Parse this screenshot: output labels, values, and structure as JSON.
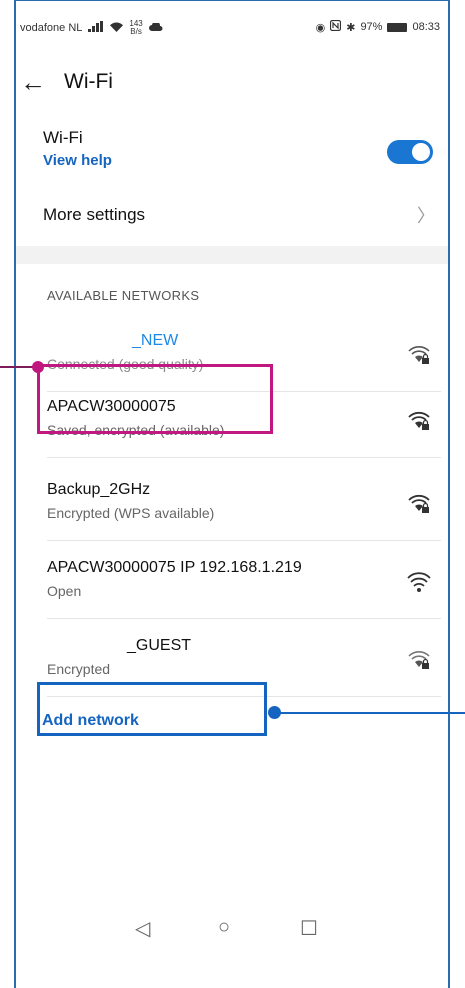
{
  "status_bar": {
    "carrier": "vodafone NL",
    "speed_value": "143",
    "speed_unit": "B/s",
    "battery": "97%",
    "time": "08:33"
  },
  "header": {
    "title": "Wi-Fi"
  },
  "wifi_toggle": {
    "label": "Wi-Fi",
    "help_link": "View help",
    "enabled": true
  },
  "more_settings": {
    "label": "More settings"
  },
  "available_networks": {
    "header": "AVAILABLE NETWORKS",
    "items": [
      {
        "name": "_NEW",
        "status": "Connected (good quality)",
        "icon": "wifi-lock-icon"
      },
      {
        "name": "APACW30000075",
        "status": "Saved, encrypted (available)",
        "icon": "wifi-lock-icon"
      },
      {
        "name": "Backup_2GHz",
        "status": "Encrypted (WPS available)",
        "icon": "wifi-lock-icon"
      },
      {
        "name": "APACW30000075 IP 192.168.1.219",
        "status": "Open",
        "icon": "wifi-icon"
      },
      {
        "name": "_GUEST",
        "status": "Encrypted",
        "icon": "wifi-lock-icon"
      }
    ]
  },
  "add_network": {
    "label": "Add network"
  },
  "colors": {
    "accent": "#1565c0",
    "annotation_pink": "#c0187f",
    "annotation_blue": "#1565c0"
  }
}
